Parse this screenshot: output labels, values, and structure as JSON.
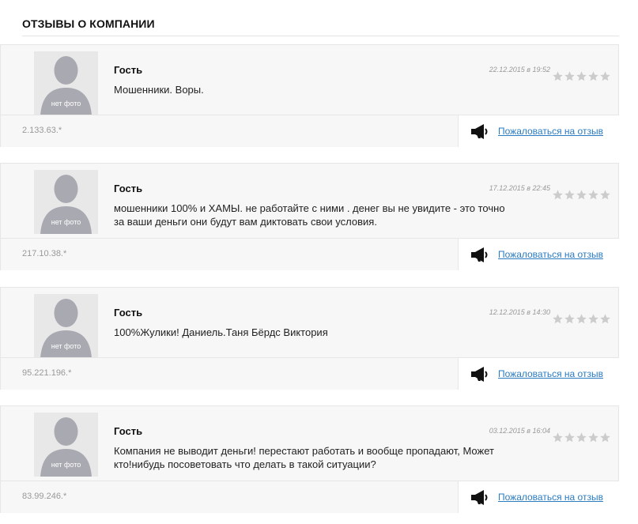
{
  "section": {
    "title": "ОТЗЫВЫ О КОМПАНИИ"
  },
  "colors": {
    "link": "#2b7bc0",
    "muted": "#999999",
    "panel": "#f7f7f7",
    "star": "#cccccc"
  },
  "reviews": [
    {
      "avatar_label": "нет фото",
      "author": "Гость",
      "date": "22.12.2015 в 19:52",
      "text": [
        "Мошенники. Воры."
      ],
      "rating": 0,
      "ip": "2.133.63.*",
      "complain_label": "Пожаловаться на отзыв"
    },
    {
      "avatar_label": "нет фото",
      "author": "Гость",
      "date": "17.12.2015 в 22:45",
      "text": [
        "мошенники 100% и ХАМЫ. не работайте с ними . денег вы не увидите - это точно",
        "за ваши деньги они будут вам диктовать свои условия."
      ],
      "rating": 0,
      "ip": "217.10.38.*",
      "complain_label": "Пожаловаться на отзыв"
    },
    {
      "avatar_label": "нет фото",
      "author": "Гость",
      "date": "12.12.2015 в 14:30",
      "text": [
        "100%Жулики! Даниель.Таня Бёрдс Виктория"
      ],
      "rating": 0,
      "ip": "95.221.196.*",
      "complain_label": "Пожаловаться на отзыв"
    },
    {
      "avatar_label": "нет фото",
      "author": "Гость",
      "date": "03.12.2015 в 16:04",
      "text": [
        "Компания не выводит деньги! перестают работать и вообще пропадают, Может",
        "кто!нибудь посоветовать что делать в такой ситуации?"
      ],
      "rating": 0,
      "ip": "83.99.246.*",
      "complain_label": "Пожаловаться на отзыв"
    }
  ]
}
